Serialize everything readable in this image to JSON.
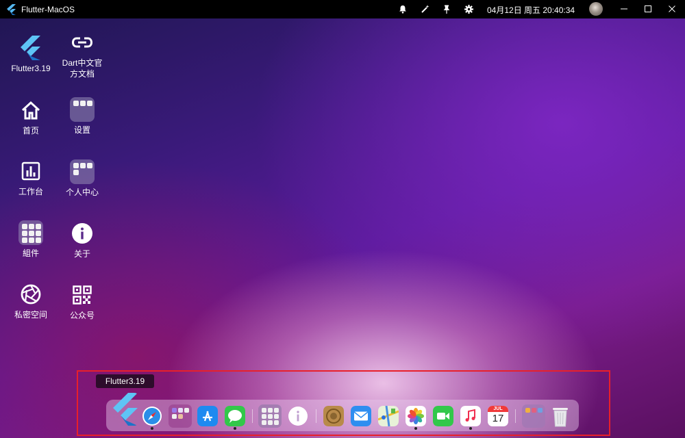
{
  "titlebar": {
    "app_title": "Flutter-MacOS",
    "clock": "04月12日 周五 20:40:34",
    "icons": [
      "bell-icon",
      "magic-wand-icon",
      "pin-icon",
      "gear-icon"
    ],
    "window_controls": [
      "minimize-icon",
      "maximize-icon",
      "close-icon"
    ]
  },
  "desktop": {
    "flutter": "Flutter3.19",
    "dart_docs": "Dart中文官方文档",
    "home": "首页",
    "settings": "设置",
    "workbench": "工作台",
    "personal": "个人中心",
    "components": "組件",
    "about": "关于",
    "private_space": "私密空间",
    "official_account": "公众号"
  },
  "dock": {
    "tooltip": "Flutter3.19",
    "apps": [
      "flutter-icon",
      "safari-icon",
      "folder-icon",
      "app-store-icon",
      "messages-icon",
      "folder-icon",
      "info-icon",
      "launchpad-icon",
      "mail-icon",
      "maps-icon",
      "photos-icon",
      "facetime-icon",
      "music-icon",
      "calendar-icon",
      "folder-icon",
      "trash-icon"
    ],
    "calendar_month": "JUL",
    "calendar_day": "17"
  },
  "colors": {
    "highlight": "#e8202a",
    "titlebar_bg": "#000000"
  }
}
